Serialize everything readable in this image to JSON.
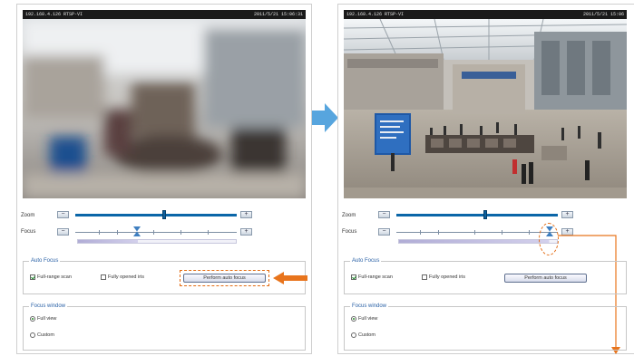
{
  "colors": {
    "accent_orange": "#e8741c",
    "slider_blue": "#0b66a8",
    "group_title": "#2a61a6",
    "transition_arrow": "#3a95d8"
  },
  "left": {
    "title_ip": "192.168.4.126 RTSP-VI",
    "title_timestamp": "2011/5/21 15:06:31",
    "zoom_label": "Zoom",
    "focus_label": "Focus",
    "zoom_minus": "−",
    "zoom_plus": "+",
    "focus_minus": "−",
    "focus_plus": "+",
    "auto_focus_title": "Auto Focus",
    "full_range_scan": "Full-range scan",
    "full_range_scan_checked": true,
    "auto_opened_iris": "Fully opened iris",
    "auto_opened_iris_checked": false,
    "perform_button": "Perform auto focus",
    "focus_window_title": "Focus window",
    "full_view": "Full view",
    "full_view_selected": true,
    "custom": "Custom",
    "custom_selected": false,
    "zoom_level": 0.55,
    "focus_level": 0.38
  },
  "right": {
    "title_ip": "192.168.4.126 RTSP-VI",
    "title_timestamp": "2011/5/21 15:06",
    "zoom_label": "Zoom",
    "focus_label": "Focus",
    "zoom_minus": "−",
    "zoom_plus": "+",
    "focus_minus": "−",
    "focus_plus": "+",
    "auto_focus_title": "Auto Focus",
    "full_range_scan": "Full-range scan",
    "full_range_scan_checked": true,
    "auto_opened_iris": "Fully opened iris",
    "auto_opened_iris_checked": false,
    "perform_button": "Perform auto focus",
    "focus_window_title": "Focus window",
    "full_view": "Full view",
    "full_view_selected": true,
    "custom": "Custom",
    "custom_selected": false,
    "zoom_level": 0.55,
    "focus_level": 0.95
  }
}
